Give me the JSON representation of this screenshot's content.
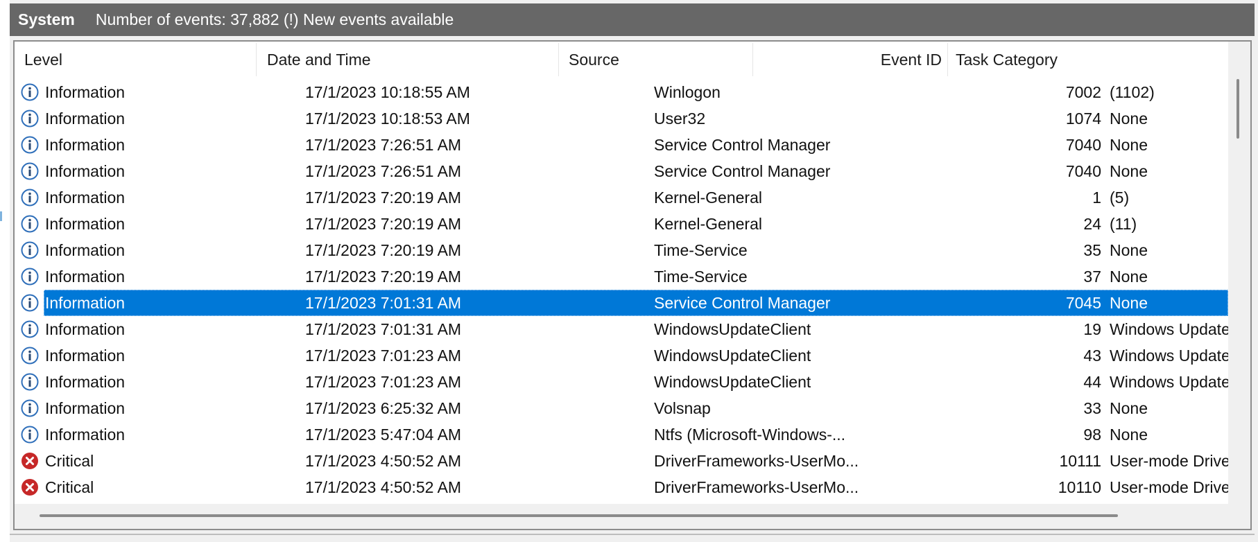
{
  "titlebar": {
    "title": "System",
    "count_text": "Number of events: 37,882 (!) New events available"
  },
  "columns": {
    "level": "Level",
    "date": "Date and Time",
    "source": "Source",
    "event_id": "Event ID",
    "task": "Task Category"
  },
  "colors": {
    "selection": "#0078d7",
    "titlebar": "#676767",
    "info_icon": "#2f6fba",
    "critical_icon": "#c62828"
  },
  "rows": [
    {
      "icon": "info-icon",
      "level": "Information",
      "date": "17/1/2023 10:18:55 AM",
      "source": "Winlogon",
      "id": "7002",
      "task": "(1102)"
    },
    {
      "icon": "info-icon",
      "level": "Information",
      "date": "17/1/2023 10:18:53 AM",
      "source": "User32",
      "id": "1074",
      "task": "None"
    },
    {
      "icon": "info-icon",
      "level": "Information",
      "date": "17/1/2023 7:26:51 AM",
      "source": "Service Control Manager",
      "id": "7040",
      "task": "None"
    },
    {
      "icon": "info-icon",
      "level": "Information",
      "date": "17/1/2023 7:26:51 AM",
      "source": "Service Control Manager",
      "id": "7040",
      "task": "None"
    },
    {
      "icon": "info-icon",
      "level": "Information",
      "date": "17/1/2023 7:20:19 AM",
      "source": "Kernel-General",
      "id": "1",
      "task": "(5)"
    },
    {
      "icon": "info-icon",
      "level": "Information",
      "date": "17/1/2023 7:20:19 AM",
      "source": "Kernel-General",
      "id": "24",
      "task": "(11)"
    },
    {
      "icon": "info-icon",
      "level": "Information",
      "date": "17/1/2023 7:20:19 AM",
      "source": "Time-Service",
      "id": "35",
      "task": "None"
    },
    {
      "icon": "info-icon",
      "level": "Information",
      "date": "17/1/2023 7:20:19 AM",
      "source": "Time-Service",
      "id": "37",
      "task": "None"
    },
    {
      "icon": "info-icon",
      "level": "Information",
      "date": "17/1/2023 7:01:31 AM",
      "source": "Service Control Manager",
      "id": "7045",
      "task": "None",
      "selected": true
    },
    {
      "icon": "info-icon",
      "level": "Information",
      "date": "17/1/2023 7:01:31 AM",
      "source": "WindowsUpdateClient",
      "id": "19",
      "task": "Windows Update"
    },
    {
      "icon": "info-icon",
      "level": "Information",
      "date": "17/1/2023 7:01:23 AM",
      "source": "WindowsUpdateClient",
      "id": "43",
      "task": "Windows Update"
    },
    {
      "icon": "info-icon",
      "level": "Information",
      "date": "17/1/2023 7:01:23 AM",
      "source": "WindowsUpdateClient",
      "id": "44",
      "task": "Windows Update"
    },
    {
      "icon": "info-icon",
      "level": "Information",
      "date": "17/1/2023 6:25:32 AM",
      "source": "Volsnap",
      "id": "33",
      "task": "None"
    },
    {
      "icon": "info-icon",
      "level": "Information",
      "date": "17/1/2023 5:47:04 AM",
      "source": "Ntfs (Microsoft-Windows-...",
      "id": "98",
      "task": "None"
    },
    {
      "icon": "critical-icon",
      "level": "Critical",
      "date": "17/1/2023 4:50:52 AM",
      "source": "DriverFrameworks-UserMo...",
      "id": "10111",
      "task": "User-mode Driver"
    },
    {
      "icon": "critical-icon",
      "level": "Critical",
      "date": "17/1/2023 4:50:52 AM",
      "source": "DriverFrameworks-UserMo...",
      "id": "10110",
      "task": "User-mode Driver"
    },
    {
      "icon": "info-icon",
      "level": "",
      "date": "",
      "source": "",
      "id": "",
      "task": ""
    }
  ]
}
